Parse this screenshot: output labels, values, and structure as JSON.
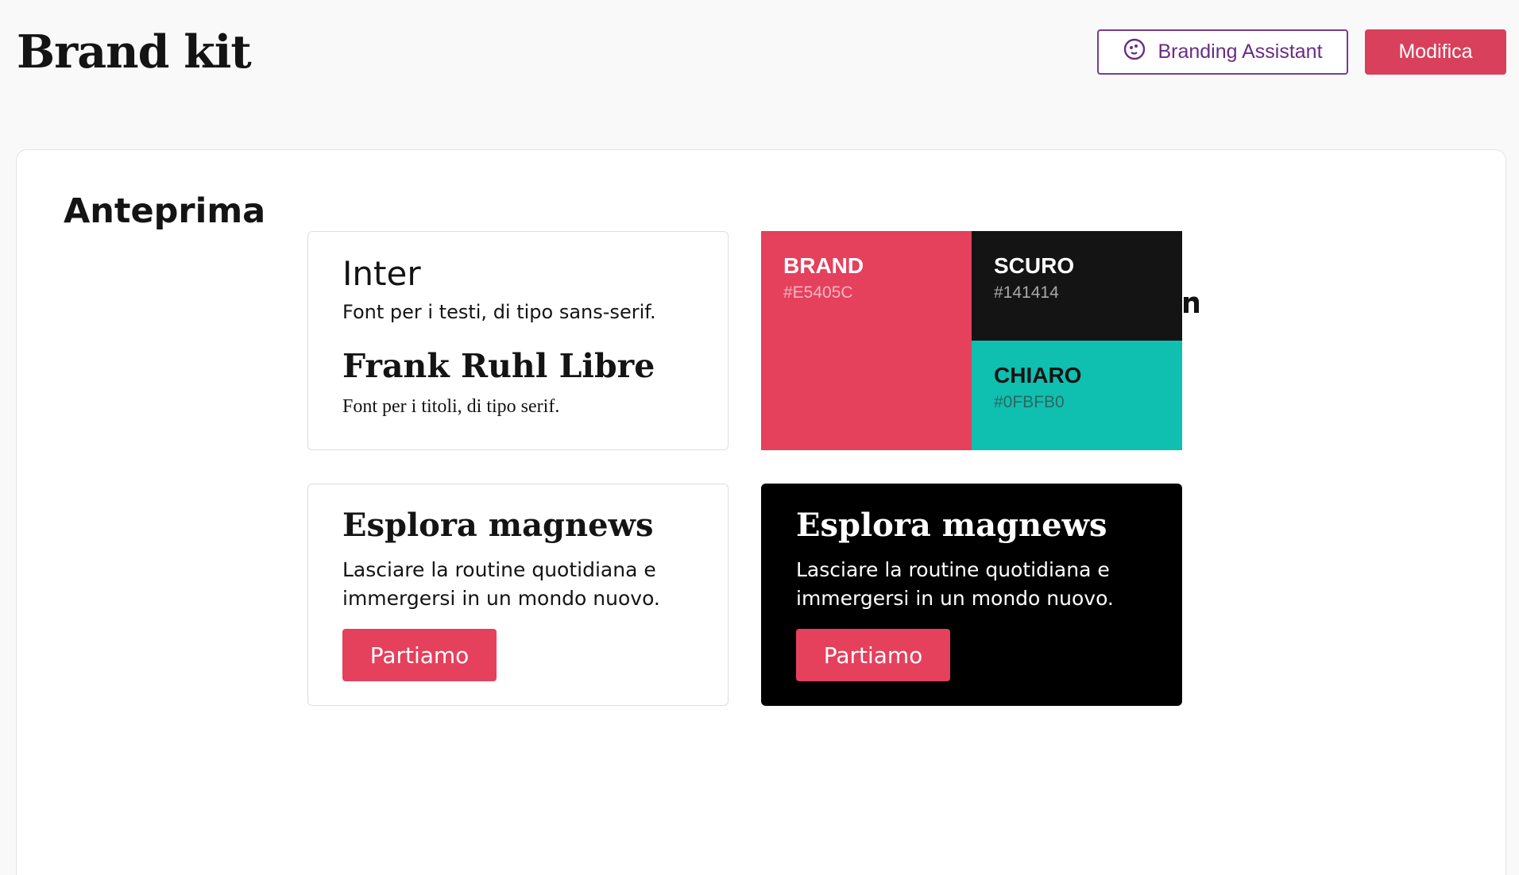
{
  "header": {
    "title": "Brand kit",
    "assistant_button": "Branding Assistant",
    "edit_button": "Modifica"
  },
  "preview": {
    "title": "Anteprima",
    "logo_icon": "magnews-m-logo",
    "socials": [
      "youtube-icon",
      "facebook-icon",
      "linkedin-icon"
    ],
    "fonts": {
      "body_name": "Inter",
      "body_desc": "Font per i testi, di tipo sans-serif.",
      "heading_name": "Frank Ruhl Libre",
      "heading_desc": "Font per i titoli, di tipo serif."
    },
    "colors": {
      "brand": {
        "name": "BRAND",
        "hex": "#E5405C"
      },
      "dark": {
        "name": "SCURO",
        "hex": "#141414"
      },
      "light": {
        "name": "CHIARO",
        "hex": "#0FBFB0"
      }
    },
    "promo_light": {
      "title": "Esplora magnews",
      "text": "Lasciare la routine quotidiana e immergersi in un mondo nuovo.",
      "button": "Partiamo"
    },
    "promo_dark": {
      "title": "Esplora magnews",
      "text": "Lasciare la routine quotidiana e immergersi in un mondo nuovo.",
      "button": "Partiamo"
    }
  },
  "accent_colors": {
    "primary": "#D8405B",
    "assistant": "#6B2C85"
  }
}
